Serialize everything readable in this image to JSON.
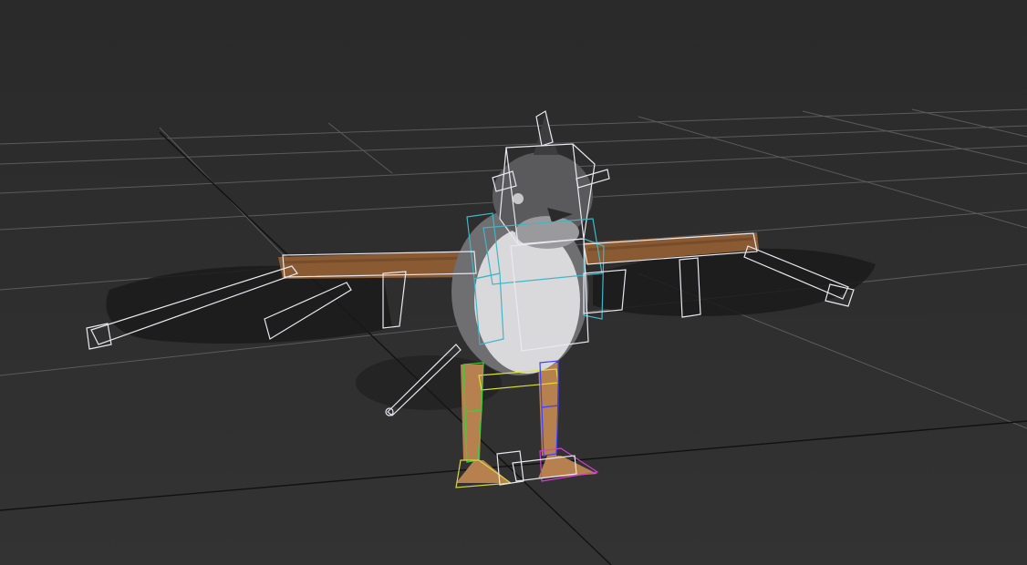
{
  "viewport": {
    "background_color": "#2e2e2e",
    "grid_color": "#6a6a6a",
    "grid_axis_color": "#111111"
  },
  "model": {
    "body_colors": {
      "feather_gray": "#7d7d7f",
      "belly_white": "#d9d9db",
      "head_dark": "#4a4a4c",
      "wing_brown": "#8a5a33",
      "leg_tan": "#b7814f",
      "shadow": "#1b1b1b"
    },
    "rig_colors": {
      "bone_white": "#e8e8f0",
      "spine_cyan": "#3fb6c8",
      "leg_green": "#3ccf3c",
      "leg_blue": "#4040ff",
      "foot_magenta": "#d040d0",
      "foot_yellow": "#d6d640",
      "pelvis_yellow": "#e0e030"
    }
  }
}
